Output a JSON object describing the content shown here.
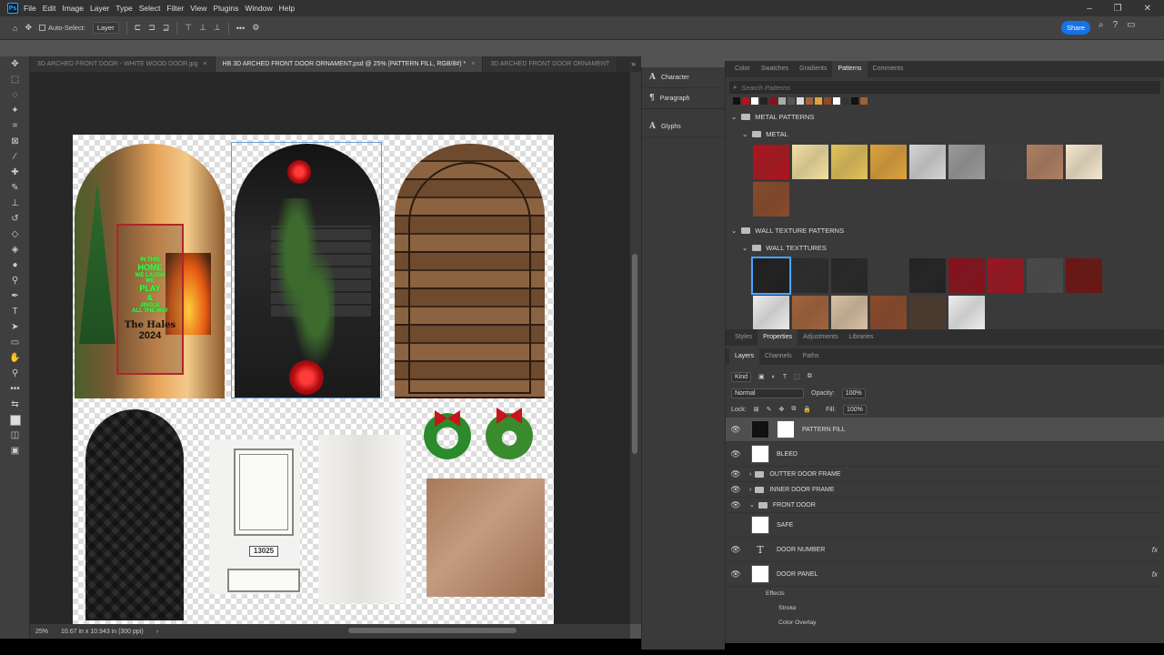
{
  "menubar": {
    "logo": "Ps",
    "items": [
      "File",
      "Edit",
      "Image",
      "Layer",
      "Type",
      "Select",
      "Filter",
      "View",
      "Plugins",
      "Window",
      "Help"
    ],
    "win_minimize": "–",
    "win_restore": "❐",
    "win_close": "✕"
  },
  "options": {
    "auto_select_label": "Auto-Select:",
    "auto_select_value": "Layer",
    "share_label": "Share"
  },
  "tabs": [
    {
      "label": "3D ARCHED FRONT DOOR - WHITE WOOD DOOR.jpg",
      "close": "×"
    },
    {
      "label": "HB 3D ARCHED FRONT DOOR ORNAMENT.psd @ 25% (PATTERN FILL, RGB/8#) *",
      "close": "×"
    },
    {
      "label": "3D ARCHED FRONT DOOR ORNAMENT",
      "close": ""
    }
  ],
  "tabs_overflow": "»",
  "canvas": {
    "sign_lines": [
      "IN THIS",
      "HOME",
      "WE LAUGH",
      "WE",
      "PLAY",
      "&",
      "JINGLE",
      "ALL THE WAY"
    ],
    "sign_name": "The Hales",
    "sign_year": "2024",
    "door_number": "13025"
  },
  "status": {
    "zoom": "25%",
    "doc_info": "10.67 in x 10.943 in (300 ppi)",
    "arrow": "›"
  },
  "mid_panel": {
    "items": [
      {
        "icon": "A",
        "label": "Character"
      },
      {
        "icon": "¶",
        "label": "Paragraph"
      },
      {
        "icon": "A",
        "label": "Glyphs"
      }
    ]
  },
  "patterns_panel": {
    "tabs": [
      "Color",
      "Swatches",
      "Gradients",
      "Patterns",
      "Comments"
    ],
    "active_tab": "Patterns",
    "search_placeholder": "Search Patterns",
    "groups": [
      {
        "label": "METAL PATTERNS",
        "sub": "METAL",
        "colors": [
          "#b0141c",
          "#f3e1a0",
          "#e5c25a",
          "#e0a23a",
          "#d5d5d5",
          "#9a9a9a",
          "#3d3d3d",
          "#b07f62",
          "#f5e7cc",
          "#8b4a2a"
        ]
      },
      {
        "label": "WALL TEXTURE PATTERNS",
        "sub": "WALL TEXTTURES",
        "colors": [
          "#1e1e1e",
          "#2a2a2a",
          "#262626",
          "#3a3a3a",
          "#222222",
          "#8b0f1a",
          "#9c1420",
          "#4a4a4a",
          "#6e1410",
          "#ececec",
          "#a3633a",
          "#d9c1a3",
          "#8c4a2a",
          "#4d3a2e",
          "#eeeeee"
        ]
      }
    ]
  },
  "properties_panel": {
    "tabs": [
      "Styles",
      "Properties",
      "Adjustments",
      "Libraries"
    ],
    "active_tab": "Properties"
  },
  "layers_panel": {
    "tabs": [
      "Layers",
      "Channels",
      "Paths"
    ],
    "active_tab": "Layers",
    "kind_label": "Kind",
    "blend_mode": "Normal",
    "opacity_label": "Opacity:",
    "opacity_value": "100%",
    "lock_label": "Lock:",
    "fill_label": "Fill:",
    "fill_value": "100%",
    "layers": [
      {
        "name": "PATTERN FILL",
        "type": "fill",
        "selected": true,
        "visible": true
      },
      {
        "name": "BLEED",
        "type": "image",
        "selected": false,
        "visible": true
      },
      {
        "name": "OUTTER DOOR FRAME",
        "type": "group",
        "selected": false,
        "visible": true
      },
      {
        "name": "INNER DOOR FRAME",
        "type": "group",
        "selected": false,
        "visible": true
      },
      {
        "name": "FRONT DOOR",
        "type": "group-open",
        "selected": false,
        "visible": true
      },
      {
        "name": "SAFE",
        "type": "image",
        "selected": false,
        "visible": false
      },
      {
        "name": "DOOR NUMBER",
        "type": "text",
        "selected": false,
        "visible": true,
        "fx": "fx"
      },
      {
        "name": "DOOR PANEL",
        "type": "image",
        "selected": false,
        "visible": true,
        "fx": "fx"
      }
    ],
    "effects": [
      "Effects",
      "Stroke",
      "Color Overlay"
    ]
  }
}
